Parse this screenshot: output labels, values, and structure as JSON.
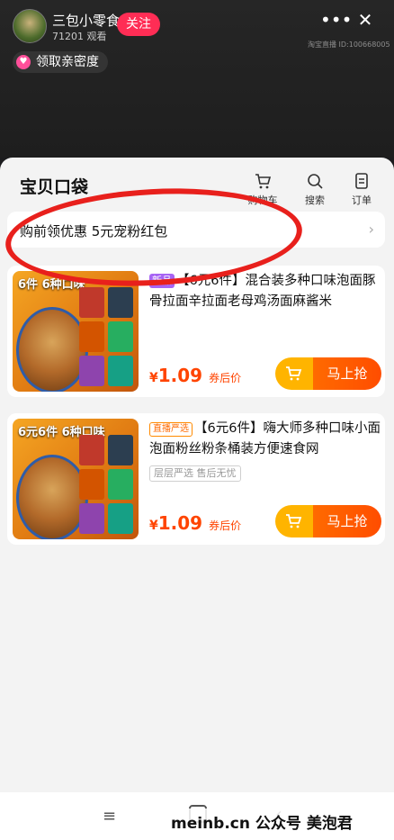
{
  "header": {
    "shop_name": "三包小零食",
    "viewers": "71201 观看",
    "follow_label": "关注",
    "more_label": "•••",
    "close_label": "✕",
    "live_id": "淘宝直播 ID:100668005",
    "intimacy_label": "领取亲密度"
  },
  "panel": {
    "title": "宝贝口袋",
    "tools": [
      {
        "label": "购物车",
        "icon": "cart-icon"
      },
      {
        "label": "搜索",
        "icon": "search-icon"
      },
      {
        "label": "订单",
        "icon": "order-icon"
      }
    ],
    "coupon_text": "购前领优惠 5元宠粉红包",
    "coupon_chevron": "›"
  },
  "products": [
    {
      "thumb_title": "6件   6种口味",
      "tag": "新品",
      "title_rest": "【6元6件】混合装多种口味泡面豚骨拉面辛拉面老母鸡汤面麻酱米",
      "price_symbol": "¥",
      "price_value": "1.09",
      "price_note": "券后价",
      "buy_label": "马上抢"
    },
    {
      "thumb_title": "6元6件  6种口味",
      "tag": "直播严选",
      "title_rest": "【6元6件】嗨大师多种口味小面泡面粉丝粉条桶装方便速食网",
      "service_tag": "层层严选 售后无忧",
      "price_symbol": "¥",
      "price_value": "1.09",
      "price_note": "券后价",
      "buy_label": "马上抢"
    }
  ],
  "bottom": {
    "menu_icon": "≡",
    "back_icon": "‹",
    "watermark": "meinb.cn  公众号 美泡君"
  },
  "colors": {
    "follow": "#ff2d55",
    "price": "#ff4400",
    "buy_gradient": "#ff6a00",
    "annotation_circle": "#e8201c"
  }
}
